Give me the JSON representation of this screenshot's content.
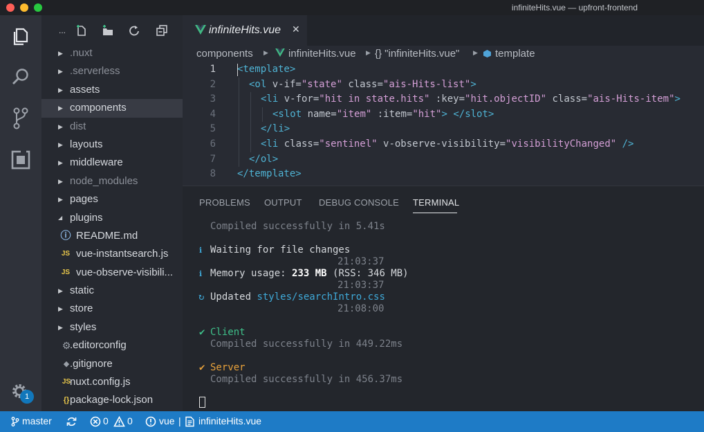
{
  "window": {
    "title": "infiniteHits.vue — upfront-frontend"
  },
  "activity_bar": {
    "items": [
      {
        "name": "explorer",
        "icon": "files-icon"
      },
      {
        "name": "search",
        "icon": "search-icon"
      },
      {
        "name": "source-control",
        "icon": "source-control-icon"
      },
      {
        "name": "extensions",
        "icon": "extensions-icon"
      }
    ],
    "settings_badge": "1"
  },
  "sidebar": {
    "toolbar": {
      "more_label": "...",
      "actions": [
        "new-file-icon",
        "new-folder-icon",
        "refresh-icon",
        "collapse-all-icon"
      ]
    },
    "tree": [
      {
        "label": ".nuxt",
        "type": "folder",
        "expanded": false,
        "dim": true
      },
      {
        "label": ".serverless",
        "type": "folder",
        "expanded": false,
        "dim": true
      },
      {
        "label": "assets",
        "type": "folder",
        "expanded": false
      },
      {
        "label": "components",
        "type": "folder",
        "expanded": false,
        "selected": true
      },
      {
        "label": "dist",
        "type": "folder",
        "expanded": false,
        "dim": true
      },
      {
        "label": "layouts",
        "type": "folder",
        "expanded": false
      },
      {
        "label": "middleware",
        "type": "folder",
        "expanded": false
      },
      {
        "label": "node_modules",
        "type": "folder",
        "expanded": false,
        "dim": true
      },
      {
        "label": "pages",
        "type": "folder",
        "expanded": false
      },
      {
        "label": "plugins",
        "type": "folder",
        "expanded": true
      },
      {
        "label": "README.md",
        "type": "file",
        "icon": "info-icon",
        "child": true
      },
      {
        "label": "vue-instantsearch.js",
        "type": "file",
        "icon": "js-icon",
        "icon_text": "JS",
        "child": true
      },
      {
        "label": "vue-observe-visibili...",
        "type": "file",
        "icon": "js-icon",
        "icon_text": "JS",
        "child": true
      },
      {
        "label": "static",
        "type": "folder",
        "expanded": false
      },
      {
        "label": "store",
        "type": "folder",
        "expanded": false
      },
      {
        "label": "styles",
        "type": "folder",
        "expanded": false
      },
      {
        "label": ".editorconfig",
        "type": "file",
        "icon": "gear-icon"
      },
      {
        "label": ".gitignore",
        "type": "file",
        "icon": "diamond-icon"
      },
      {
        "label": "nuxt.config.js",
        "type": "file",
        "icon": "js-icon",
        "icon_text": "JS"
      },
      {
        "label": "package-lock.json",
        "type": "file",
        "icon": "json-icon",
        "icon_text": "{}"
      }
    ]
  },
  "editor": {
    "tab": {
      "label": "infiniteHits.vue",
      "close": "✕"
    },
    "breadcrumb": [
      "components",
      "infiniteHits.vue",
      "{} \"infiniteHits.vue\"",
      "template"
    ],
    "lines": [
      {
        "n": "1",
        "indent": 0,
        "tokens": [
          [
            "tag",
            "<template>"
          ]
        ]
      },
      {
        "n": "2",
        "indent": 1,
        "tokens": [
          [
            "tag",
            "<ol "
          ],
          [
            "attr",
            "v-if="
          ],
          [
            "str",
            "\"state\""
          ],
          [
            "attr",
            " class="
          ],
          [
            "str",
            "\"ais-Hits-list\""
          ],
          [
            "tag",
            ">"
          ]
        ]
      },
      {
        "n": "3",
        "indent": 2,
        "tokens": [
          [
            "tag",
            "<li "
          ],
          [
            "attr",
            "v-for="
          ],
          [
            "str",
            "\"hit in state.hits\""
          ],
          [
            "attr",
            " :key="
          ],
          [
            "str",
            "\"hit.objectID\""
          ],
          [
            "attr",
            " class="
          ],
          [
            "str",
            "\"ais-Hits-item\""
          ],
          [
            "tag",
            ">"
          ]
        ]
      },
      {
        "n": "4",
        "indent": 3,
        "tokens": [
          [
            "tag",
            "<slot "
          ],
          [
            "attr",
            "name="
          ],
          [
            "str",
            "\"item\""
          ],
          [
            "attr",
            " :item="
          ],
          [
            "str",
            "\"hit\""
          ],
          [
            "tag",
            "> </slot>"
          ]
        ]
      },
      {
        "n": "5",
        "indent": 2,
        "tokens": [
          [
            "tag",
            "</li>"
          ]
        ]
      },
      {
        "n": "6",
        "indent": 2,
        "tokens": [
          [
            "tag",
            "<li "
          ],
          [
            "attr",
            "class="
          ],
          [
            "str",
            "\"sentinel\""
          ],
          [
            "attr",
            " v-observe-visibility="
          ],
          [
            "str",
            "\"visibilityChanged\""
          ],
          [
            "tag",
            " />"
          ]
        ]
      },
      {
        "n": "7",
        "indent": 1,
        "tokens": [
          [
            "tag",
            "</ol>"
          ]
        ]
      },
      {
        "n": "8",
        "indent": 0,
        "tokens": [
          [
            "tag",
            "</template>"
          ]
        ]
      }
    ]
  },
  "panel": {
    "tabs": [
      "PROBLEMS",
      "OUTPUT",
      "DEBUG CONSOLE",
      "TERMINAL"
    ],
    "active_tab": "TERMINAL",
    "terminal": {
      "compiled_1": "Compiled successfully in 5.41s",
      "waiting": "Waiting for file changes",
      "time_1": "21:03:37",
      "memory_prefix": "Memory usage: ",
      "memory_value": "233 MB",
      "memory_suffix": " (RSS: 346 MB)",
      "time_2": "21:03:37",
      "updated_prefix": "Updated ",
      "updated_file": "styles/searchIntro.css",
      "time_3": "21:08:00",
      "client_label": "Client",
      "client_compiled": "Compiled successfully in 449.22ms",
      "server_label": "Server",
      "server_compiled": "Compiled successfully in 456.37ms",
      "check": "✔",
      "info": "ℹ",
      "refresh": "↻"
    }
  },
  "status_bar": {
    "branch": "master",
    "errors": "0",
    "warnings": "0",
    "language": "vue",
    "separator": "|",
    "file": "infiniteHits.vue"
  },
  "colors": {
    "accent": "#1e7bc6",
    "tag": "#4fb3d4",
    "string": "#d49fd6",
    "success": "#3fc08a",
    "warning": "#e9a23b"
  }
}
